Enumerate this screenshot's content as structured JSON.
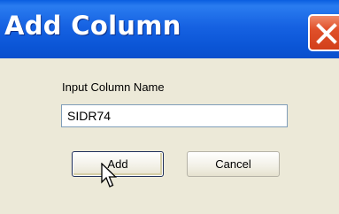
{
  "window": {
    "title": "Add Column",
    "close_icon": "close-icon"
  },
  "dialog": {
    "prompt_label": "Input Column Name",
    "column_name_value": "SIDR74",
    "add_label": "Add",
    "cancel_label": "Cancel"
  },
  "colors": {
    "titlebar": "#0b55d6",
    "close_button": "#d23f1a",
    "background": "#ece9d8"
  }
}
